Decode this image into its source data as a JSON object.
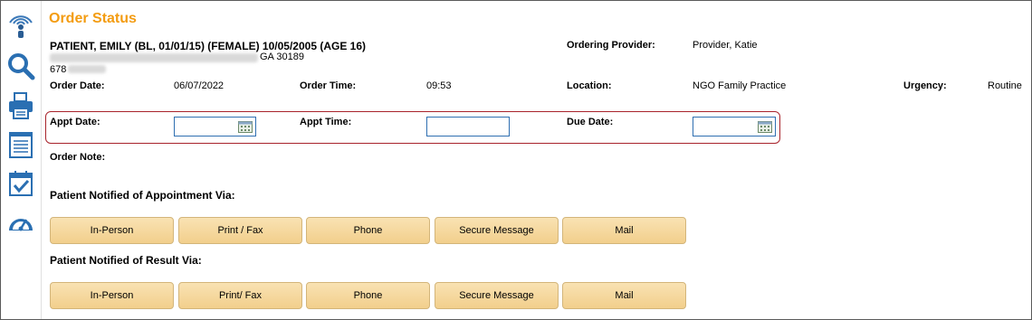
{
  "sidebar": {
    "icons": [
      "wireless-broadcast-icon",
      "magnifier-icon",
      "printer-icon",
      "notepad-icon",
      "calendar-check-icon",
      "speedometer-icon"
    ]
  },
  "title": "Order Status",
  "patient": {
    "name_line": "PATIENT, EMILY (BL, 01/01/15) (FEMALE) 10/05/2005 (AGE 16)",
    "address_tail": "GA 30189",
    "phone_prefix": "678"
  },
  "provider": {
    "label": "Ordering Provider:",
    "value": "Provider, Katie"
  },
  "order": {
    "date_label": "Order Date:",
    "date_value": "06/07/2022",
    "time_label": "Order Time:",
    "time_value": "09:53",
    "location_label": "Location:",
    "location_value": "NGO Family Practice",
    "urgency_label": "Urgency:",
    "urgency_value": "Routine",
    "note_label": "Order Note:"
  },
  "appt": {
    "date_label": "Appt Date:",
    "date_value": "",
    "time_label": "Appt Time:",
    "time_value": "",
    "due_label": "Due Date:",
    "due_value": ""
  },
  "appointment_notified": {
    "heading": "Patient Notified of Appointment Via:",
    "buttons": [
      "In-Person",
      "Print / Fax",
      "Phone",
      "Secure Message",
      "Mail"
    ]
  },
  "result_notified": {
    "heading": "Patient Notified of Result Via:",
    "buttons": [
      "In-Person",
      "Print/ Fax",
      "Phone",
      "Secure Message",
      "Mail"
    ]
  },
  "colors": {
    "title": "#f39c12",
    "accent_blue": "#2f6fb1",
    "appt_border": "#a8232b",
    "button_fill": "#f2cf8c"
  }
}
